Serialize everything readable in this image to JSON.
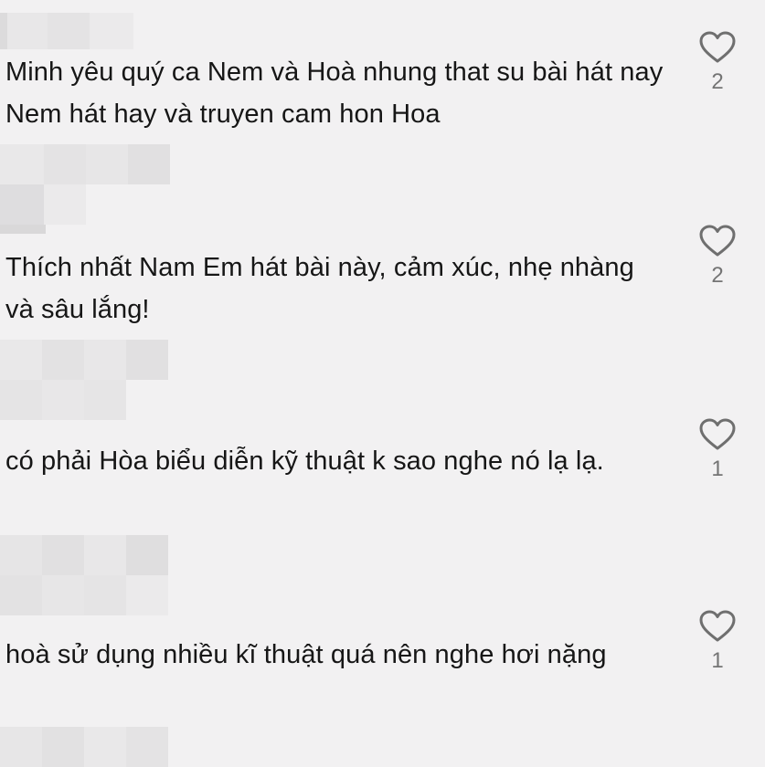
{
  "comments": [
    {
      "text": "Minh yêu quý ca Nem và Hoà nhung that su bài hát nay Nem hát hay và truyen cam hon Hoa",
      "likes": "2"
    },
    {
      "text": "Thích nhất Nam Em hát bài này, cảm xúc, nhẹ nhàng và sâu lắng!",
      "likes": "2"
    },
    {
      "text": "có phải Hòa biểu diễn kỹ thuật k sao nghe nó lạ lạ.",
      "likes": "1"
    },
    {
      "text": "hoà sử dụng nhiều kĩ thuật quá nên nghe hơi nặng",
      "likes": "1"
    }
  ],
  "icons": {
    "like": "heart-outline-icon",
    "avatar": "blurred-avatar"
  },
  "colors": {
    "background": "#f2f1f2",
    "text": "#161616",
    "like_count": "#747474",
    "heart_stroke": "#6f6f6f"
  }
}
